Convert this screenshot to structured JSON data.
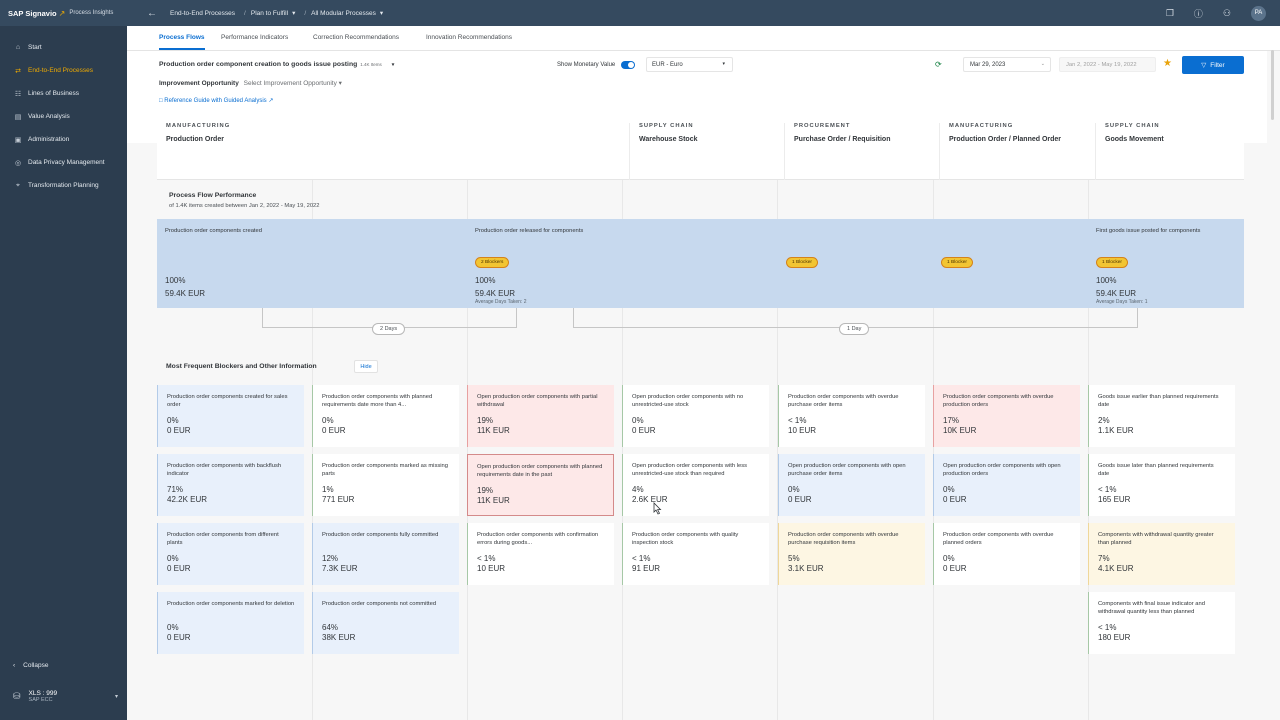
{
  "topbar": {
    "brand": "SAP Signavio",
    "product": "Process Insights",
    "breadcrumbs": [
      "End-to-End Processes",
      "Plan to Fulfill",
      "All Modular Processes"
    ],
    "avatar": "PA"
  },
  "sidebar": {
    "items": [
      {
        "label": "Start",
        "icon": "home-icon"
      },
      {
        "label": "End-to-End Processes",
        "icon": "process-icon",
        "active": true
      },
      {
        "label": "Lines of Business",
        "icon": "org-chart-icon"
      },
      {
        "label": "Value Analysis",
        "icon": "value-icon"
      },
      {
        "label": "Administration",
        "icon": "admin-icon"
      },
      {
        "label": "Data Privacy Management",
        "icon": "privacy-icon"
      },
      {
        "label": "Transformation Planning",
        "icon": "transformation-icon"
      }
    ],
    "collapse": "Collapse",
    "system": {
      "name": "XLS : 999",
      "type": "SAP ECC"
    }
  },
  "tabs": [
    "Process Flows",
    "Performance Indicators",
    "Correction Recommendations",
    "Innovation Recommendations"
  ],
  "header": {
    "title": "Production order component creation to goods issue posting",
    "count": "1.4K Items",
    "improvement_label": "Improvement Opportunity",
    "improvement_select": "Select Improvement Opportunity",
    "reference": "Reference Guide with Guided Analysis",
    "monetary_label": "Show Monetary Value",
    "currency": "EUR - Euro",
    "date": "Mar 29, 2023",
    "date_range": "Jan 2, 2022 - May 19, 2022",
    "filter": "Filter"
  },
  "columns": [
    {
      "category": "MANUFACTURING",
      "title": "Production Order"
    },
    {
      "category": "SUPPLY CHAIN",
      "title": "Warehouse Stock"
    },
    {
      "category": "PROCUREMENT",
      "title": "Purchase Order / Requisition"
    },
    {
      "category": "MANUFACTURING",
      "title": "Production Order / Planned Order"
    },
    {
      "category": "SUPPLY CHAIN",
      "title": "Goods Movement"
    }
  ],
  "performance": {
    "title": "Process Flow Performance",
    "subtitle": "of 1.4K items created between Jan 2, 2022 - May 19, 2022",
    "steps": [
      {
        "label": "Production order components created",
        "pct": "100%",
        "eur": "59.4K EUR",
        "avg": ""
      },
      {
        "label": "Production order released for components",
        "pct": "100%",
        "eur": "59.4K EUR",
        "avg": "Average Days Taken: 2",
        "blocker": "2 Blockers"
      },
      {
        "label": "First goods issue posted for components",
        "pct": "100%",
        "eur": "59.4K EUR",
        "avg": "Average Days Taken: 1",
        "blocker": "1 Blocker"
      }
    ],
    "blockers": [
      "1 Blocker",
      "1 Blocker"
    ],
    "durations": [
      "2 Days",
      "1 Day"
    ]
  },
  "blockers": {
    "title": "Most Frequent Blockers and Other Information",
    "hide": "Hide",
    "cards": [
      {
        "text": "Production order components created for sales order",
        "pct": "0%",
        "eur": "0 EUR",
        "tone": "blue"
      },
      {
        "text": "Production order components with planned requirements date more than 4...",
        "pct": "0%",
        "eur": "0 EUR",
        "tone": "white"
      },
      {
        "text": "Open production order components with partial withdrawal",
        "pct": "19%",
        "eur": "11K EUR",
        "tone": "red"
      },
      {
        "text": "Open production order components with no unrestricted-use stock",
        "pct": "0%",
        "eur": "0 EUR",
        "tone": "white"
      },
      {
        "text": "Production order components with overdue purchase order items",
        "pct": "< 1%",
        "eur": "10 EUR",
        "tone": "white"
      },
      {
        "text": "Production order components with overdue production orders",
        "pct": "17%",
        "eur": "10K EUR",
        "tone": "red"
      },
      {
        "text": "Goods issue earlier than planned requirements date",
        "pct": "2%",
        "eur": "1.1K EUR",
        "tone": "white"
      },
      {
        "text": "Production order components with backflush indicator",
        "pct": "71%",
        "eur": "42.2K EUR",
        "tone": "blue"
      },
      {
        "text": "Production order components marked as missing parts",
        "pct": "1%",
        "eur": "771 EUR",
        "tone": "white"
      },
      {
        "text": "Open production order components with planned requirements date in the past",
        "pct": "19%",
        "eur": "11K EUR",
        "tone": "red"
      },
      {
        "text": "Open production order components with less unrestricted-use stock than required",
        "pct": "4%",
        "eur": "2.6K EUR",
        "tone": "white"
      },
      {
        "text": "Open production order components with open purchase order items",
        "pct": "0%",
        "eur": "0 EUR",
        "tone": "blue"
      },
      {
        "text": "Open production order components with open production orders",
        "pct": "0%",
        "eur": "0 EUR",
        "tone": "blue"
      },
      {
        "text": "Goods issue later than planned requirements date",
        "pct": "< 1%",
        "eur": "165 EUR",
        "tone": "white"
      },
      {
        "text": "Production order components from different plants",
        "pct": "0%",
        "eur": "0 EUR",
        "tone": "blue"
      },
      {
        "text": "Production order components fully committed",
        "pct": "12%",
        "eur": "7.3K EUR",
        "tone": "blue"
      },
      {
        "text": "Production order components with confirmation errors during goods...",
        "pct": "< 1%",
        "eur": "10 EUR",
        "tone": "white"
      },
      {
        "text": "Production order components with quality inspection stock",
        "pct": "< 1%",
        "eur": "91 EUR",
        "tone": "white"
      },
      {
        "text": "Production order components with overdue purchase requisition items",
        "pct": "5%",
        "eur": "3.1K EUR",
        "tone": "yellow"
      },
      {
        "text": "Production order components with overdue planned orders",
        "pct": "0%",
        "eur": "0 EUR",
        "tone": "white"
      },
      {
        "text": "Components with withdrawal quantity greater than planned",
        "pct": "7%",
        "eur": "4.1K EUR",
        "tone": "yellow"
      },
      {
        "text": "Production order components marked for deletion",
        "pct": "0%",
        "eur": "0 EUR",
        "tone": "blue"
      },
      {
        "text": "Production order components not committed",
        "pct": "64%",
        "eur": "38K EUR",
        "tone": "blue"
      },
      {
        "text": "Components with final issue indicator and withdrawal quantity less than planned",
        "pct": "< 1%",
        "eur": "180 EUR",
        "tone": "white"
      }
    ]
  },
  "colors": {
    "accent": "#0a6ed1",
    "shell": "#354a5f",
    "sidebar": "#2c3d4f",
    "active_nav": "#f0ab00",
    "blocker": "#f2c532"
  }
}
